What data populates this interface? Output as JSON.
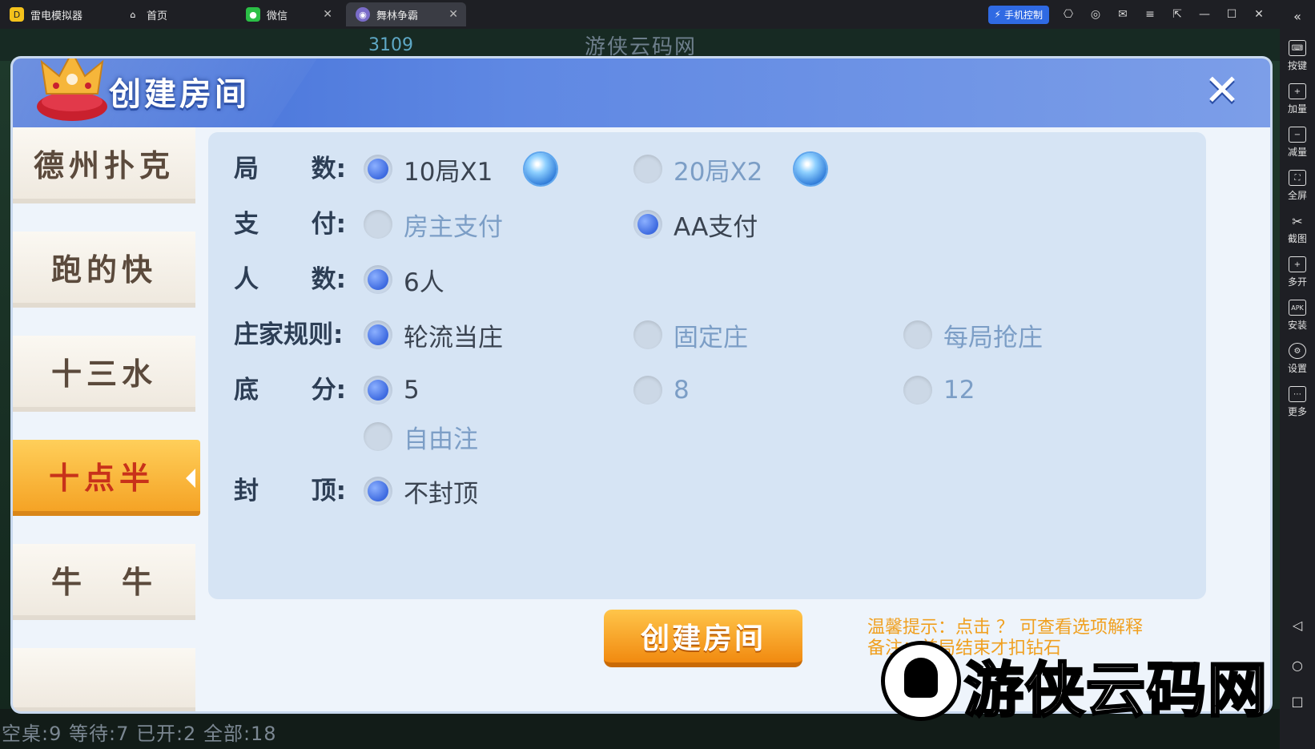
{
  "titlebar": {
    "tabs": [
      {
        "label": "雷电模拟器"
      },
      {
        "label": "首页"
      },
      {
        "label": "微信"
      },
      {
        "label": "舞林争霸"
      }
    ],
    "phone_control": "手机控制"
  },
  "sidebar": {
    "items": [
      {
        "label": "按键",
        "icon": "keyboard-icon"
      },
      {
        "label": "加量",
        "icon": "volume-up-icon"
      },
      {
        "label": "减量",
        "icon": "volume-down-icon"
      },
      {
        "label": "全屏",
        "icon": "fullscreen-icon"
      },
      {
        "label": "截图",
        "icon": "scissors-icon"
      },
      {
        "label": "多开",
        "icon": "multi-instance-icon"
      },
      {
        "label": "安装",
        "icon": "apk-icon"
      },
      {
        "label": "设置",
        "icon": "gear-icon"
      },
      {
        "label": "更多",
        "icon": "more-icon"
      }
    ]
  },
  "background": {
    "coins": "3109",
    "watermark_top": "游侠云码网",
    "status": "空桌:9 等待:7 已开:2 全部:18"
  },
  "dialog": {
    "title": "创建房间",
    "game_tabs": [
      {
        "label": "德州扑克"
      },
      {
        "label": "跑的快"
      },
      {
        "label": "十三水"
      },
      {
        "label": "十点半",
        "active": true
      },
      {
        "label": "牛　牛"
      }
    ],
    "options": {
      "rounds": {
        "label_a": "局",
        "label_b": "数:",
        "choices": [
          {
            "text": "10局X1",
            "selected": true
          },
          {
            "text": "20局X2",
            "selected": false
          }
        ]
      },
      "payment": {
        "label_a": "支",
        "label_b": "付:",
        "choices": [
          {
            "text": "房主支付",
            "selected": false
          },
          {
            "text": "AA支付",
            "selected": true
          }
        ]
      },
      "players": {
        "label_a": "人",
        "label_b": "数:",
        "choices": [
          {
            "text": "6人",
            "selected": true
          }
        ]
      },
      "dealer": {
        "label": "庄家规则:",
        "choices": [
          {
            "text": "轮流当庄",
            "selected": true
          },
          {
            "text": "固定庄",
            "selected": false
          },
          {
            "text": "每局抢庄",
            "selected": false
          }
        ]
      },
      "base": {
        "label_a": "底",
        "label_b": "分:",
        "choices": [
          {
            "text": "5",
            "selected": true
          },
          {
            "text": "8",
            "selected": false
          },
          {
            "text": "12",
            "selected": false
          },
          {
            "text": "自由注",
            "selected": false
          }
        ]
      },
      "cap": {
        "label_a": "封",
        "label_b": "顶:",
        "choices": [
          {
            "text": "不封顶",
            "selected": true
          }
        ]
      }
    },
    "create_button": "创建房间",
    "tip_line1": "温馨提示：点击 ？ 可查看选项解释",
    "tip_line2": "备注：首局结束才扣钻石"
  },
  "watermark": {
    "text": "游侠云码网"
  },
  "colors": {
    "header": "#4f7be0",
    "accent_orange": "#f5a325",
    "radio_on": "#3d6ae0"
  }
}
